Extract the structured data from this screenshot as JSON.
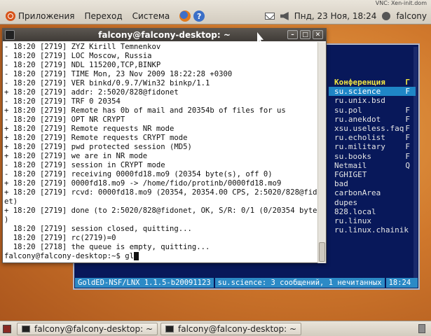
{
  "vnc_label": "VNC: Xen-init.dom",
  "top_panel": {
    "menus": [
      "Приложения",
      "Переход",
      "Система"
    ],
    "datetime": "Пнд, 23 Ноя, 18:24",
    "user": "falcony"
  },
  "terminal": {
    "title": "falcony@falcony-desktop: ~",
    "lines": [
      "- 18:20 [2719] ZYZ Kirill Temnenkov",
      "- 18:20 [2719] LOC Moscow, Russia",
      "- 18:20 [2719] NDL 115200,TCP,BINKP",
      "- 18:20 [2719] TIME Mon, 23 Nov 2009 18:22:28 +0300",
      "- 18:20 [2719] VER binkd/0.9.7/Win32 binkp/1.1",
      "+ 18:20 [2719] addr: 2:5020/828@fidonet",
      "- 18:20 [2719] TRF 0 20354",
      "+ 18:20 [2719] Remote has 0b of mail and 20354b of files for us",
      "- 18:20 [2719] OPT NR CRYPT",
      "+ 18:20 [2719] Remote requests NR mode",
      "+ 18:20 [2719] Remote requests CRYPT mode",
      "+ 18:20 [2719] pwd protected session (MD5)",
      "+ 18:20 [2719] we are in NR mode",
      "- 18:20 [2719] session in CRYPT mode",
      "- 18:20 [2719] receiving 0000fd18.mo9 (20354 byte(s), off 0)",
      "+ 18:20 [2719] 0000fd18.mo9 -> /home/fido/protinb/0000fd18.mo9",
      "+ 18:20 [2719] rcvd: 0000fd18.mo9 (20354, 20354.00 CPS, 2:5020/828@fidon",
      "et)",
      "+ 18:20 [2719] done (to 2:5020/828@fidonet, OK, S/R: 0/1 (0/20354 bytes)",
      ")",
      "  18:20 [2719] session closed, quitting...",
      "  18:20 [2719] rc(2719)=0",
      "  18:20 [2718] the queue is empty, quitting...",
      "falcony@falcony-desktop:~$ gl"
    ]
  },
  "golded": {
    "header": {
      "name": "Конференция",
      "flag": "Г"
    },
    "areas": [
      {
        "name": "su.science",
        "flag": "F",
        "selected": true
      },
      {
        "name": "ru.unix.bsd",
        "flag": ""
      },
      {
        "name": "su.pol",
        "flag": "F"
      },
      {
        "name": "ru.anekdot",
        "flag": "F"
      },
      {
        "name": "xsu.useless.faq",
        "flag": "F"
      },
      {
        "name": "ru.echolist",
        "flag": "F"
      },
      {
        "name": "ru.military",
        "flag": "F"
      },
      {
        "name": "su.books",
        "flag": "F"
      },
      {
        "name": "Netmail",
        "flag": "Q"
      },
      {
        "name": "FGHIGET",
        "flag": ""
      },
      {
        "name": "bad",
        "flag": ""
      },
      {
        "name": "carbonArea",
        "flag": ""
      },
      {
        "name": "dupes",
        "flag": ""
      },
      {
        "name": "828.local",
        "flag": ""
      },
      {
        "name": "ru.linux",
        "flag": ""
      },
      {
        "name": "ru.linux.chainik",
        "flag": ""
      }
    ],
    "status": {
      "version": "GoldED-NSF/LNX 1.1.5-b20091123",
      "info": "su.science: 3 сообщений, 1 нечитанных",
      "time": "18:24"
    }
  },
  "taskbar": {
    "tasks": [
      "falcony@falcony-desktop: ~",
      "falcony@falcony-desktop: ~"
    ]
  },
  "colors": {
    "golded_bg": "#08185a",
    "golded_highlight": "#1f86c6",
    "golded_header": "#f4e642"
  }
}
